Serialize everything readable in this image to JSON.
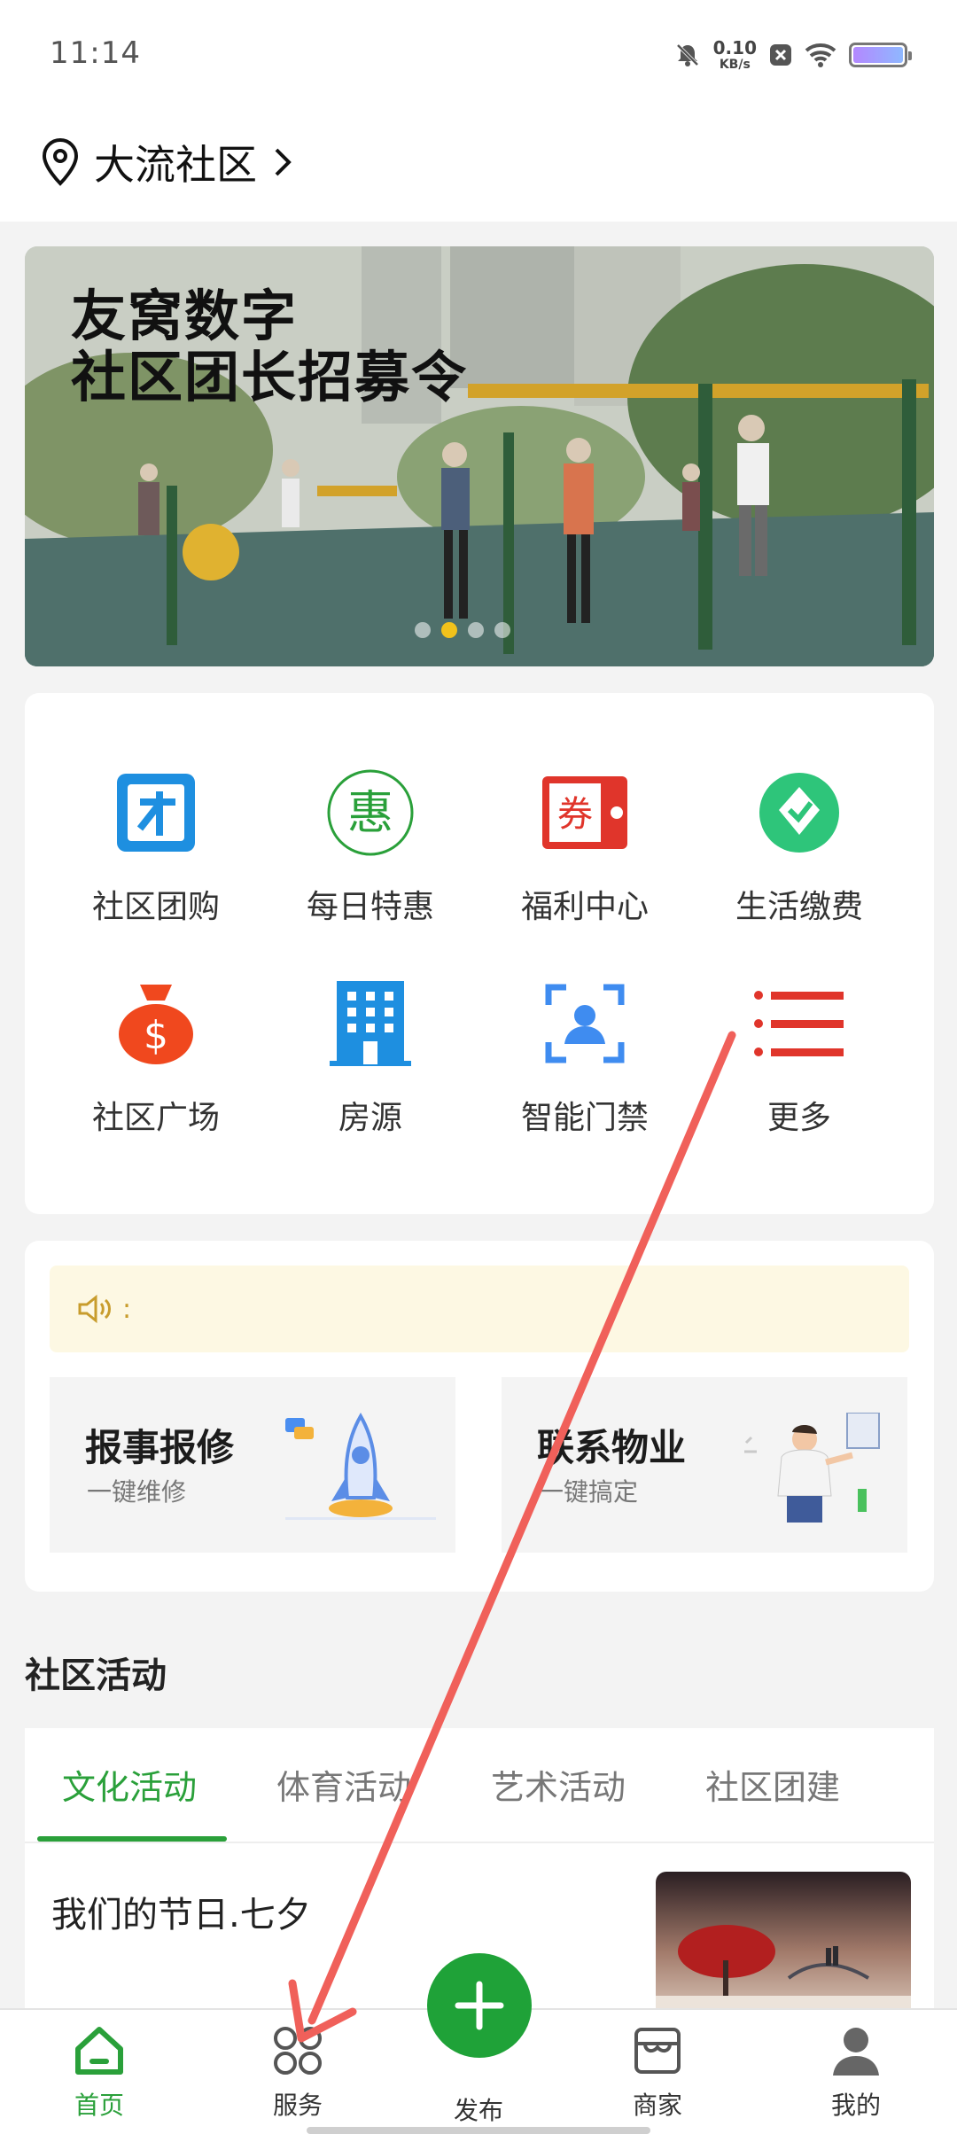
{
  "status_bar": {
    "time": "11:14",
    "net_speed_value": "0.10",
    "net_speed_unit": "KB/s",
    "icons": [
      "mute-bell-icon",
      "close-box-icon",
      "wifi-icon",
      "battery-icon"
    ]
  },
  "header": {
    "location": "大流社区",
    "icon": "location-pin-icon"
  },
  "banner": {
    "title_line1": "友窝数字",
    "title_line2": "社区团长招募令",
    "dots": 4,
    "active_dot": 2
  },
  "services": [
    {
      "label": "社区团购",
      "icon": "group-buy-icon",
      "color": "#1e8fe0"
    },
    {
      "label": "每日特惠",
      "icon": "daily-deal-icon",
      "color": "#2aa03a"
    },
    {
      "label": "福利中心",
      "icon": "coupon-icon",
      "color": "#e0352b"
    },
    {
      "label": "生活缴费",
      "icon": "bill-payment-icon",
      "color": "#2ec57a"
    },
    {
      "label": "社区广场",
      "icon": "money-bag-icon",
      "color": "#f0481e"
    },
    {
      "label": "房源",
      "icon": "building-icon",
      "color": "#1e8fe0"
    },
    {
      "label": "智能门禁",
      "icon": "face-access-icon",
      "color": "#3f8cf0"
    },
    {
      "label": "更多",
      "icon": "more-list-icon",
      "color": "#e0352b"
    }
  ],
  "notice": {
    "icon": "speaker-icon",
    "text": ":"
  },
  "quick_actions": [
    {
      "title": "报事报修",
      "subtitle": "一键维修",
      "illustration": "rocket-illustration"
    },
    {
      "title": "联系物业",
      "subtitle": "一键搞定",
      "illustration": "person-illustration"
    }
  ],
  "activities": {
    "section_title": "社区活动",
    "tabs": [
      "文化活动",
      "体育活动",
      "艺术活动",
      "社区团建"
    ],
    "active_tab": 0,
    "items": [
      {
        "title": "我们的节日.七夕"
      }
    ]
  },
  "bottom_nav": {
    "items": [
      {
        "label": "首页",
        "icon": "home-icon",
        "active": true
      },
      {
        "label": "服务",
        "icon": "grid-icon",
        "active": false
      },
      {
        "label": "发布",
        "icon": "plus-icon",
        "active": false
      },
      {
        "label": "商家",
        "icon": "shop-icon",
        "active": false
      },
      {
        "label": "我的",
        "icon": "user-icon",
        "active": false
      }
    ]
  },
  "colors": {
    "accent": "#2aa03a",
    "annotation_arrow": "#f0605a"
  }
}
